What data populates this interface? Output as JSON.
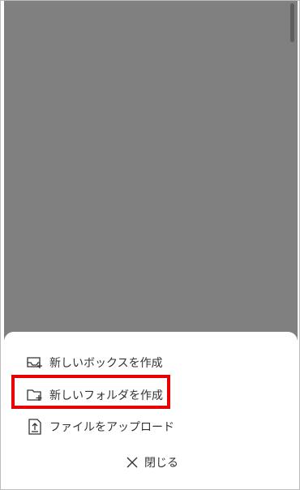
{
  "menu": {
    "items": [
      {
        "label": "新しいボックスを作成",
        "icon": "new-box-icon"
      },
      {
        "label": "新しいフォルダを作成",
        "icon": "new-folder-icon",
        "highlighted": true
      },
      {
        "label": "ファイルをアップロード",
        "icon": "upload-file-icon"
      }
    ],
    "close_label": "閉じる"
  },
  "colors": {
    "overlay": "#808080",
    "sheet_background": "#ffffff",
    "text": "#333333",
    "highlight": "#e60000"
  }
}
